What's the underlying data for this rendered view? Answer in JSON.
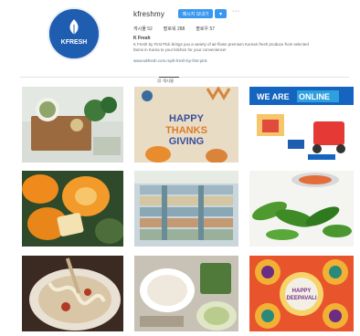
{
  "profile": {
    "avatar_text": "KFRESH",
    "username": "kfreshmy",
    "message_label": "메시지 보내기",
    "follow_label": "▾",
    "more_label": "···",
    "stats": [
      {
        "label": "게시물",
        "value": "52"
      },
      {
        "label": "팔로워",
        "value": "288"
      },
      {
        "label": "팔로우",
        "value": "57"
      }
    ],
    "bio_name": "K Fresh",
    "bio_text": "K Fresh by First Pick brings you a variety of air-flown premium Korean fresh produce from selected farms in Korea to your kitchen for your convenience!",
    "bio_link": "www.wkfresh.com.my/k-fresh-by-first-pick"
  },
  "tabs": {
    "posts_label": "▦ 게시물"
  },
  "posts": [
    {
      "caption": ""
    },
    {
      "caption": "HAPPY THANKS GIVING"
    },
    {
      "caption": "WE ARE ONLINE"
    },
    {
      "caption": ""
    },
    {
      "caption": ""
    },
    {
      "caption": ""
    },
    {
      "caption": ""
    },
    {
      "caption": ""
    },
    {
      "caption": "HAPPY DEEPAVALI"
    }
  ],
  "colors": {
    "brand_blue": "#1f5db0",
    "button_blue": "#3897f0",
    "online_blue": "#1565c0",
    "thanks_bg": "#e8dcc4"
  }
}
